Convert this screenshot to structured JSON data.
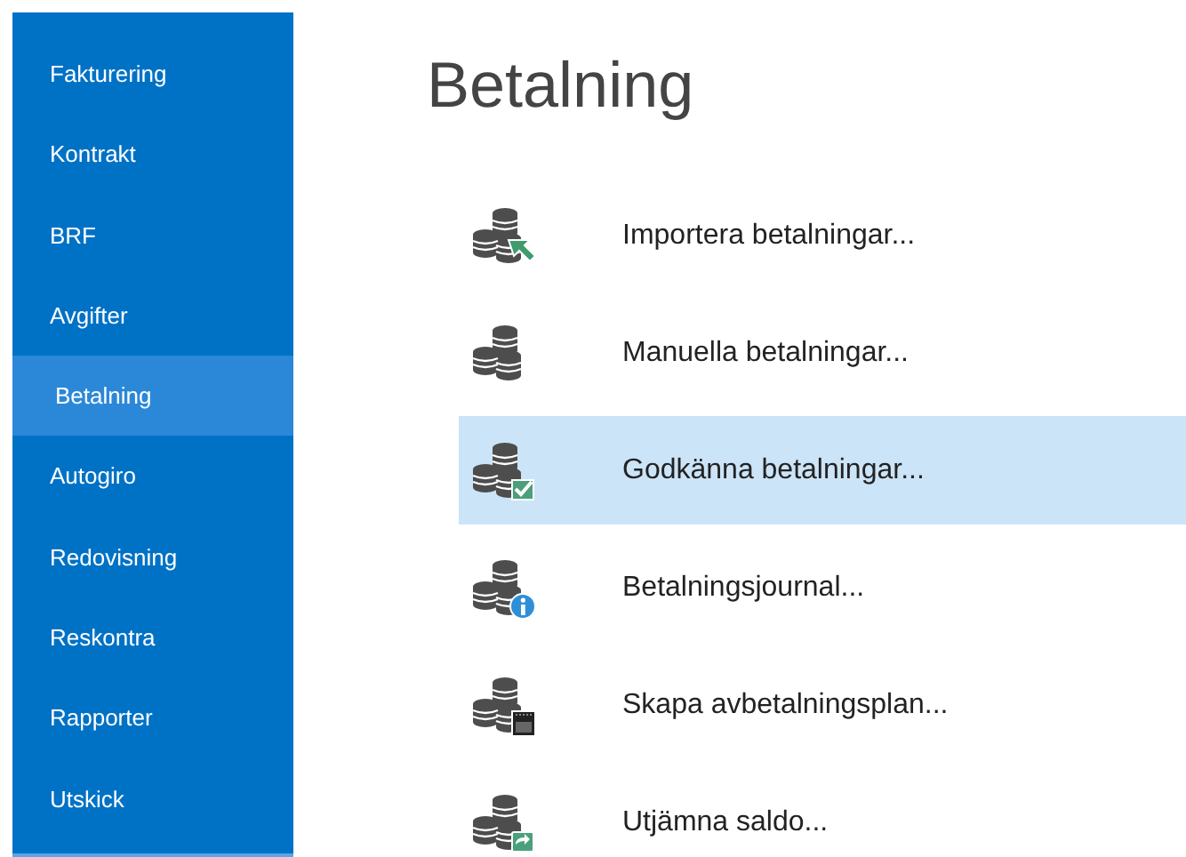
{
  "sidebar": {
    "items": [
      {
        "label": "Fakturering",
        "selected": false
      },
      {
        "label": "Kontrakt",
        "selected": false
      },
      {
        "label": "BRF",
        "selected": false
      },
      {
        "label": "Avgifter",
        "selected": false
      },
      {
        "label": "Betalning",
        "selected": true
      },
      {
        "label": "Autogiro",
        "selected": false
      },
      {
        "label": "Redovisning",
        "selected": false
      },
      {
        "label": "Reskontra",
        "selected": false
      },
      {
        "label": "Rapporter",
        "selected": false
      },
      {
        "label": "Utskick",
        "selected": false
      }
    ]
  },
  "title": "Betalning",
  "actions": [
    {
      "label": "Importera betalningar...",
      "kind": "import",
      "selected": false
    },
    {
      "label": "Manuella betalningar...",
      "kind": "plain",
      "selected": false
    },
    {
      "label": "Godkänna betalningar...",
      "kind": "approve",
      "selected": true
    },
    {
      "label": "Betalningsjournal...",
      "kind": "info",
      "selected": false
    },
    {
      "label": "Skapa avbetalningsplan...",
      "kind": "calendar",
      "selected": false
    },
    {
      "label": "Utjämna saldo...",
      "kind": "sync",
      "selected": false
    }
  ]
}
